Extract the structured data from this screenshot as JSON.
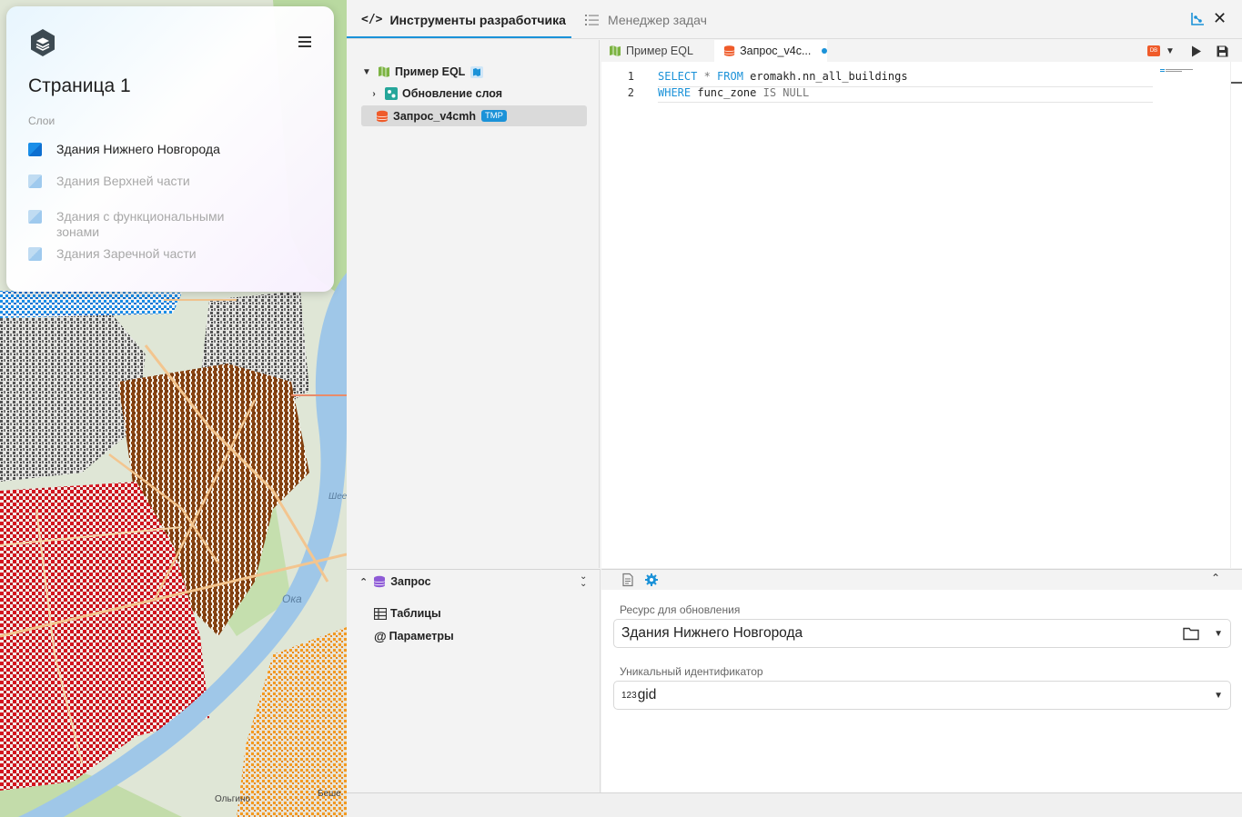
{
  "map": {
    "labels": {
      "river": "Ока",
      "street": "Шее",
      "district_1": "Ольгино",
      "district_2": "Беше"
    }
  },
  "layer_panel": {
    "page_title": "Страница 1",
    "layers_label": "Слои",
    "layers": [
      {
        "name": "Здания Нижнего Новгорода",
        "visible": true
      },
      {
        "name": "Здания Верхней части",
        "visible": false
      },
      {
        "name": "Здания с функциональными зонами",
        "visible": false
      },
      {
        "name": "Здания Заречной части",
        "visible": false
      }
    ]
  },
  "devtools": {
    "tabs": {
      "devtools_label": "Инструменты разработчика",
      "taskmgr_label": "Менеджер задач"
    },
    "tree": {
      "root_label": "Пример EQL",
      "child_label": "Обновление слоя",
      "query_label": "Запрос_v4cmh",
      "query_badge": "TMP"
    },
    "editor": {
      "tabs": {
        "eql_label": "Пример EQL",
        "query_label": "Запрос_v4c..."
      },
      "db_badge": "DB",
      "lines": [
        {
          "number": "1",
          "parts": {
            "kw1": "SELECT",
            "op1": " * ",
            "kw2": "FROM",
            "rest": " eromakh.nn_all_buildings"
          }
        },
        {
          "number": "2",
          "parts": {
            "kw1": "WHERE",
            "rest": " func_zone ",
            "kw2": "IS",
            "kw3": " NULL"
          }
        }
      ]
    },
    "bottom_left": {
      "query_label": "Запрос",
      "tables_label": "Таблицы",
      "params_label": "Параметры"
    },
    "bottom_right": {
      "resource_label": "Ресурс для обновления",
      "resource_value": "Здания Нижнего Новгорода",
      "id_label": "Уникальный идентификатор",
      "id_prefix": "123",
      "id_value": "gid"
    },
    "colors": {
      "accent": "#1b92d8",
      "brown": "#8b4513",
      "red": "#d4141e"
    }
  }
}
